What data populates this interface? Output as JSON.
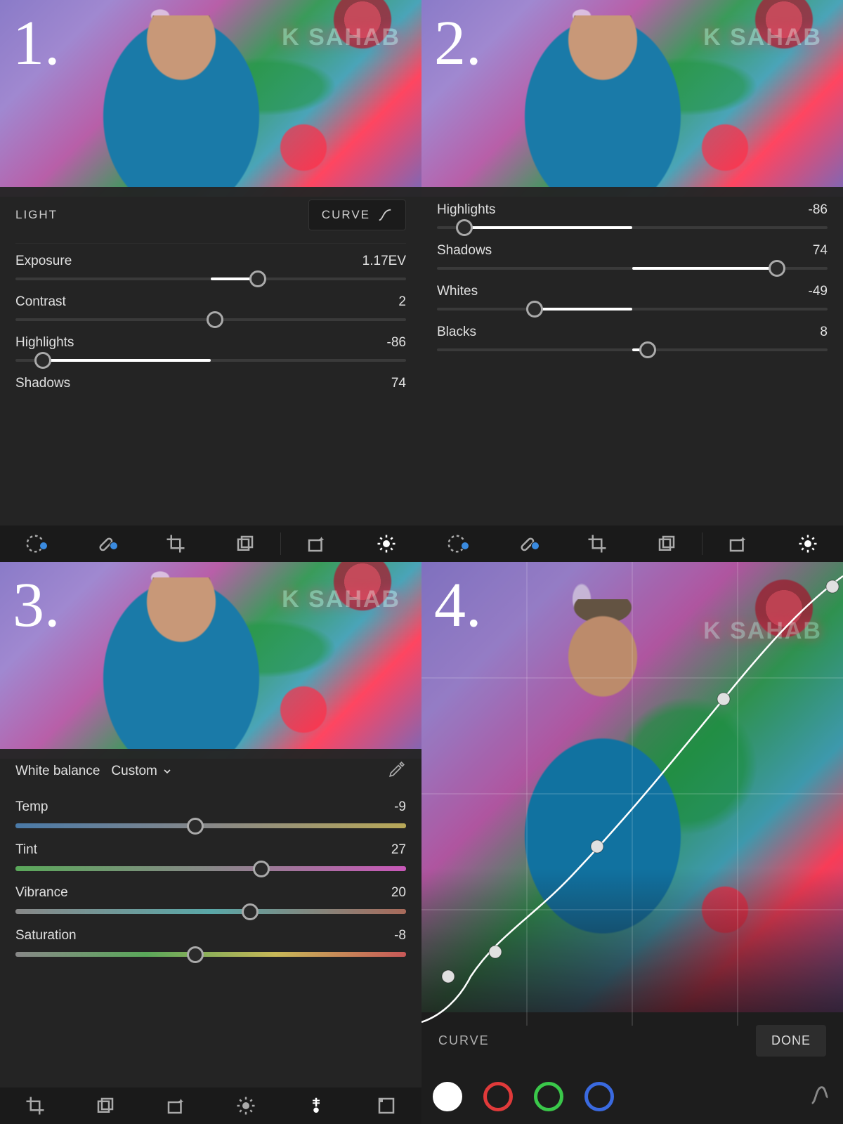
{
  "steps": [
    "1.",
    "2.",
    "3.",
    "4."
  ],
  "panel1": {
    "section": "LIGHT",
    "curve_button": "CURVE",
    "sliders": [
      {
        "label": "Exposure",
        "value_text": "1.17EV",
        "thumb_pct": 62,
        "fill_from": 50,
        "fill_to": 62
      },
      {
        "label": "Contrast",
        "value_text": "2",
        "thumb_pct": 51,
        "fill_from": 50,
        "fill_to": 51
      },
      {
        "label": "Highlights",
        "value_text": "-86",
        "thumb_pct": 7,
        "fill_from": 7,
        "fill_to": 50
      },
      {
        "label": "Shadows",
        "value_text": "74",
        "thumb_pct": 87,
        "fill_from": 50,
        "fill_to": 87,
        "track_hidden": true
      }
    ]
  },
  "panel2": {
    "sliders": [
      {
        "label": "Highlights",
        "value_text": "-86",
        "thumb_pct": 7,
        "fill_from": 7,
        "fill_to": 50
      },
      {
        "label": "Shadows",
        "value_text": "74",
        "thumb_pct": 87,
        "fill_from": 50,
        "fill_to": 87
      },
      {
        "label": "Whites",
        "value_text": "-49",
        "thumb_pct": 25,
        "fill_from": 25,
        "fill_to": 50
      },
      {
        "label": "Blacks",
        "value_text": "8",
        "thumb_pct": 54,
        "fill_from": 50,
        "fill_to": 54
      }
    ]
  },
  "panel3": {
    "wb_label": "White balance",
    "wb_mode": "Custom",
    "sliders": [
      {
        "label": "Temp",
        "value_text": "-9",
        "thumb_pct": 46,
        "grad": "g-temp"
      },
      {
        "label": "Tint",
        "value_text": "27",
        "thumb_pct": 63,
        "grad": "g-tint"
      },
      {
        "label": "Vibrance",
        "value_text": "20",
        "thumb_pct": 60,
        "grad": "g-vib"
      },
      {
        "label": "Saturation",
        "value_text": "-8",
        "thumb_pct": 46,
        "grad": "g-sat"
      }
    ]
  },
  "panel4": {
    "curve_label": "CURVE",
    "done_label": "DONE"
  }
}
